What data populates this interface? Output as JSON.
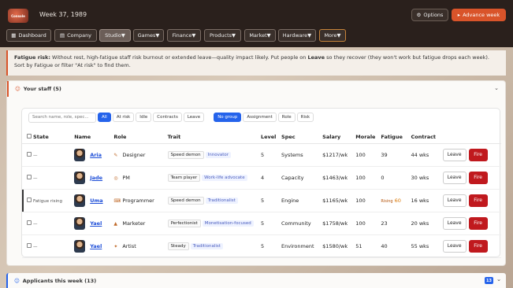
{
  "app": {
    "logo_text": "Console",
    "week": "Week 37, 1989"
  },
  "header": {
    "options_label": "Options",
    "advance_label": "Advance week"
  },
  "nav": [
    {
      "label": "Dashboard"
    },
    {
      "label": "Company"
    },
    {
      "label": "Studio▼"
    },
    {
      "label": "Games▼"
    },
    {
      "label": "Finance▼"
    },
    {
      "label": "Products▼"
    },
    {
      "label": "Market▼"
    },
    {
      "label": "Hardware▼"
    },
    {
      "label": "More▼"
    }
  ],
  "banner": {
    "bold": "Fatigue risk:",
    "text1": " Without rest, high-fatigue staff risk burnout or extended leave—quality impact likely. Put people on ",
    "bold2": "Leave",
    "text2": " so they recover (they won't work but fatigue drops each week). Sort by Fatigue or filter \"At risk\" to find them."
  },
  "staff_panel": {
    "title": "Your staff (5)"
  },
  "filters": {
    "search_placeholder": "Search name, role, spec...",
    "state_chips": [
      "All",
      "At risk",
      "Idle",
      "Contracts",
      "Leave"
    ],
    "group_chips": [
      "No group",
      "Assignment",
      "Role",
      "Risk"
    ]
  },
  "columns": [
    "State",
    "Name",
    "Role",
    "Trait",
    "Level",
    "Spec",
    "Salary",
    "Morale",
    "Fatigue",
    "Contract"
  ],
  "rows": [
    {
      "state": "—",
      "name": "Aria",
      "role": "Designer",
      "trait": "Speed demon",
      "trait2": "Innovator",
      "level": "5",
      "spec": "Systems",
      "salary": "$1217/wk",
      "morale": "100",
      "fatigue": "39",
      "fatigue_note": "",
      "contract": "44 wks"
    },
    {
      "state": "—",
      "name": "Jade",
      "role": "PM",
      "trait": "Team player",
      "trait2": "Work-life advocate",
      "level": "4",
      "spec": "Capacity",
      "salary": "$1463/wk",
      "morale": "100",
      "fatigue": "0",
      "fatigue_note": "",
      "contract": "30 wks"
    },
    {
      "state": "Fatigue rising",
      "name": "Uma",
      "role": "Programmer",
      "trait": "Speed demon",
      "trait2": "Traditionalist",
      "level": "5",
      "spec": "Engine",
      "salary": "$1165/wk",
      "morale": "100",
      "fatigue": "60",
      "fatigue_note": "Rising",
      "contract": "16 wks"
    },
    {
      "state": "—",
      "name": "Yael",
      "role": "Marketer",
      "trait": "Perfectionist",
      "trait2": "Monetisation-focused",
      "level": "5",
      "spec": "Community",
      "salary": "$1758/wk",
      "morale": "100",
      "fatigue": "23",
      "fatigue_note": "",
      "contract": "20 wks"
    },
    {
      "state": "—",
      "name": "Yael",
      "role": "Artist",
      "trait": "Steady",
      "trait2": "Traditionalist",
      "level": "5",
      "spec": "Environment",
      "salary": "$1580/wk",
      "morale": "51",
      "fatigue": "40",
      "fatigue_note": "",
      "contract": "55 wks"
    }
  ],
  "actions": {
    "leave": "Leave",
    "fire": "Fire"
  },
  "applicants": {
    "title": "Applicants this week (13)",
    "count": "13"
  }
}
